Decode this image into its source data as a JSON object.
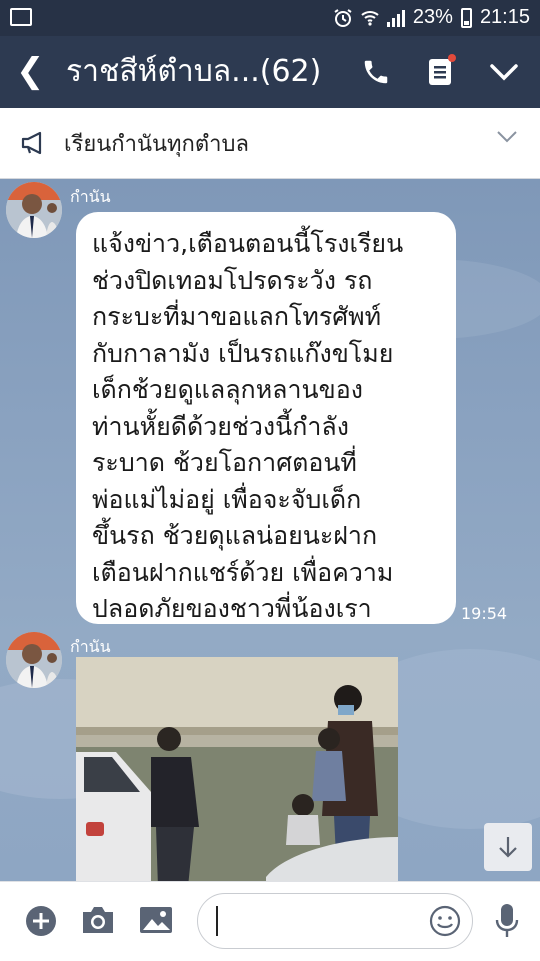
{
  "status_bar": {
    "battery": "23%",
    "time": "21:15",
    "icons": [
      "gallery-icon",
      "alarm-icon",
      "wifi-icon",
      "signal-icon",
      "battery-icon"
    ]
  },
  "header": {
    "title": "ราชสีห์ตำบล...(62)",
    "icons": [
      "back-icon",
      "phone-icon",
      "notes-icon",
      "chevron-down-icon"
    ],
    "notification_dot_color": "#e24a3b"
  },
  "announcement": {
    "text": "เรียนกำนันทุกตำบล",
    "icons": [
      "megaphone-icon",
      "chevron-down-icon"
    ]
  },
  "messages": [
    {
      "sender": "กำนัน",
      "type": "text",
      "lines": [
        "แจ้งข่าว,เตือนตอนนี้โรงเรียน",
        "ช่วงปิดเทอมโปรดระวัง รถ",
        "กระบะที่มาขอแลกโทรศัพท์",
        "กับกาลามัง เป็นรถแก๊งขโมย",
        "เด็กช้วยดูแลลุกหลานของ",
        "ท่านหั้ยดีด้วยช่วงนี้กำลัง",
        "ระบาด ช้วยโอกาศตอนที่",
        "พ่อแม่ไม่อยู่ เพื่อจะจับเด็ก",
        "ขึ้นรถ ช้วยดุแลน่อยนะฝาก",
        "เตือนฝากแชร์ด้วย เพื่อความ",
        "ปลอดภัยของชาวพี่น้องเรา"
      ],
      "time": "19:54"
    },
    {
      "sender": "กำนัน",
      "type": "image"
    }
  ],
  "composer": {
    "placeholder": "",
    "icons": [
      "plus-icon",
      "camera-icon",
      "image-icon",
      "emoji-icon",
      "microphone-icon"
    ]
  },
  "colors": {
    "header_bg": "#2d3a51",
    "status_bg": "#273246",
    "chat_bg": "#8aa2c0",
    "bubble_bg": "#ffffff"
  }
}
